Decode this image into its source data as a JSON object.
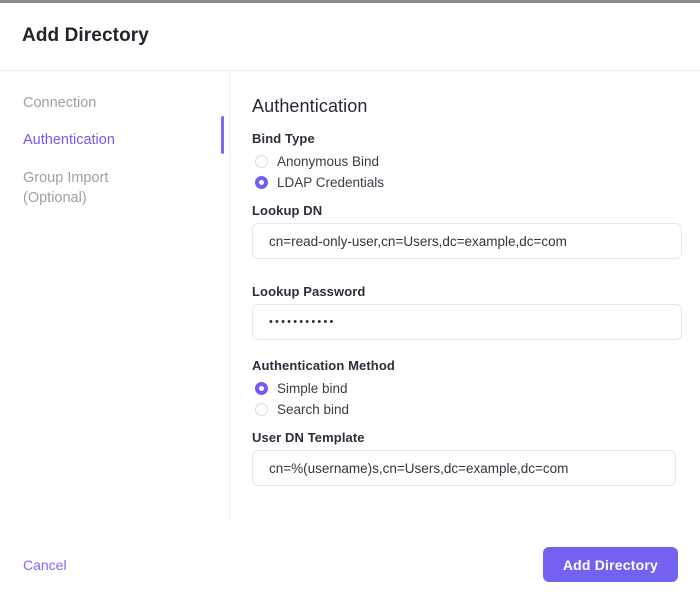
{
  "dialog": {
    "title": "Add Directory"
  },
  "sidebar": {
    "items": [
      {
        "label": "Connection",
        "active": false
      },
      {
        "label": "Authentication",
        "active": true
      },
      {
        "label": "Group Import\n(Optional)",
        "active": false
      }
    ]
  },
  "main": {
    "section_title": "Authentication",
    "bind_type": {
      "label": "Bind Type",
      "options": [
        {
          "label": "Anonymous Bind",
          "selected": false
        },
        {
          "label": "LDAP Credentials",
          "selected": true
        }
      ]
    },
    "lookup_dn": {
      "label": "Lookup DN",
      "value": "cn=read-only-user,cn=Users,dc=example,dc=com"
    },
    "lookup_password": {
      "label": "Lookup Password",
      "value": "•••••••••••"
    },
    "auth_method": {
      "label": "Authentication Method",
      "options": [
        {
          "label": "Simple bind",
          "selected": true
        },
        {
          "label": "Search bind",
          "selected": false
        }
      ]
    },
    "user_dn_template": {
      "label": "User DN Template",
      "value": "cn=%(username)s,cn=Users,dc=example,dc=com"
    }
  },
  "footer": {
    "cancel_label": "Cancel",
    "submit_label": "Add Directory"
  },
  "colors": {
    "accent": "#7362f2",
    "accent_text": "#6f5cf0",
    "muted_text": "#9ca0a8",
    "top_strip": "#8b8b93"
  }
}
